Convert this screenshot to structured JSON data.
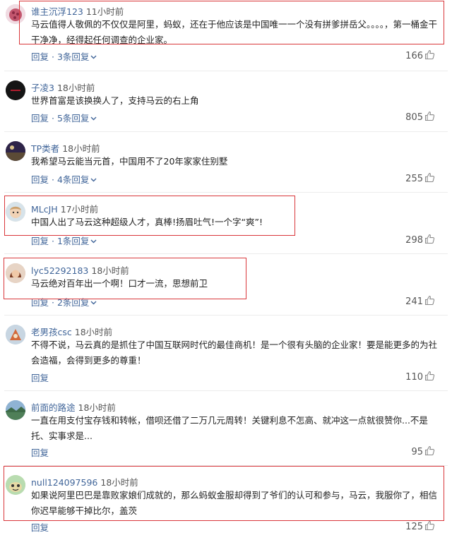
{
  "comments": [
    {
      "user": "谁主沉浮123",
      "time": "11小时前",
      "text": "马云值得人敬佩的不仅仅是阿里，蚂蚁，还在于他应该是中国唯一一个没有拼爹拼岳父。。。。，第一桶金干干净净，经得起任何调查的企业家。",
      "reply_label": "回复",
      "replies": "3条回复",
      "likes": "166"
    },
    {
      "user": "子凌3",
      "time": "18小时前",
      "text": "世界首富是该换换人了，支持马云的右上角",
      "reply_label": "回复",
      "replies": "5条回复",
      "likes": "805"
    },
    {
      "user": "TP类者",
      "time": "18小时前",
      "text": "我希望马云能当元首，中国用不了20年家家住别墅",
      "reply_label": "回复",
      "replies": "4条回复",
      "likes": "255"
    },
    {
      "user": "MLcJH",
      "time": "17小时前",
      "text": "中国人出了马云这种超级人才，真棒!扬眉吐气!一个字“爽”!",
      "reply_label": "回复",
      "replies": "1条回复",
      "likes": "298"
    },
    {
      "user": "lyc52292183",
      "time": "18小时前",
      "text": "马云绝对百年出一个啊！口才一流，思想前卫",
      "reply_label": "回复",
      "replies": "2条回复",
      "likes": "241"
    },
    {
      "user": "老男孩csc",
      "time": "18小时前",
      "text": "不得不说，马云真的是抓住了中国互联网时代的最佳商机！是一个很有头脑的企业家！要是能更多的为社会造福，会得到更多的尊重！",
      "reply_label": "回复",
      "replies": "",
      "likes": "110"
    },
    {
      "user": "前面的路途",
      "time": "18小时前",
      "text": "一直在用支付宝存钱和转帐，借呗还借了二万几元周转！关键利息不怎高、就冲这一点就很赞你...不是托、实事求是...",
      "reply_label": "回复",
      "replies": "",
      "likes": "95"
    },
    {
      "user": "null124097596",
      "time": "18小时前",
      "text": "如果说阿里巴巴是靠败家娘们成就的，那么蚂蚁金服却得到了爷们的认可和参与，马云，我服你了，相信你迟早能够干掉比尔，盖茨",
      "reply_label": "回复",
      "replies": "",
      "likes": "125"
    }
  ],
  "reply_separator": " · ",
  "colors": {
    "username": "#406599",
    "highlight": "#d9373b"
  }
}
